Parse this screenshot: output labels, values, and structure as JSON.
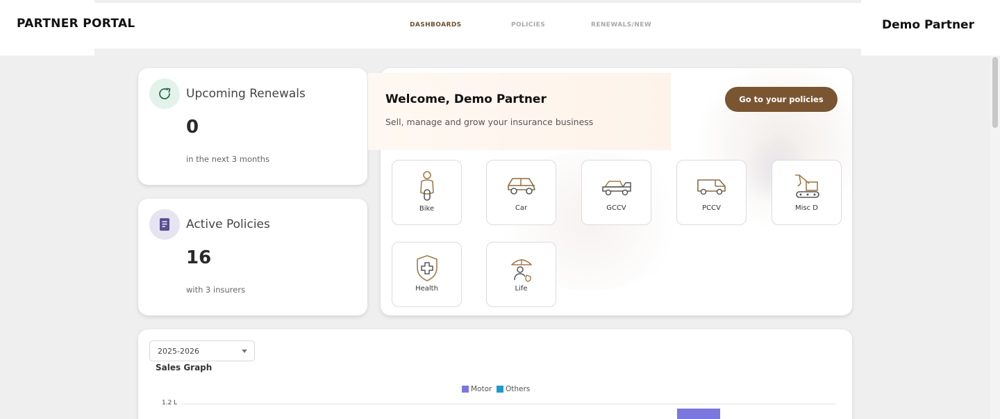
{
  "header": {
    "brand": "PARTNER PORTAL",
    "user_name": "Demo Partner",
    "nav": [
      {
        "label": "DASHBOARDS",
        "active": true
      },
      {
        "label": "POLICIES",
        "active": false
      },
      {
        "label": "RENEWALS/NEW",
        "active": false
      }
    ]
  },
  "stats": {
    "renewals": {
      "icon": "refresh-icon",
      "title": "Upcoming Renewals",
      "value": "0",
      "sub": "in the next 3 months"
    },
    "policies": {
      "icon": "document-icon",
      "title": "Active Policies",
      "value": "16",
      "sub": "with 3 insurers"
    }
  },
  "welcome": {
    "title": "Welcome, Demo Partner",
    "subtitle": "Sell, manage and grow your insurance business",
    "cta": "Go to your policies"
  },
  "products": [
    {
      "label": "Bike",
      "icon": "scooter-icon"
    },
    {
      "label": "Car",
      "icon": "car-icon"
    },
    {
      "label": "GCCV",
      "icon": "tow-truck-icon"
    },
    {
      "label": "PCCV",
      "icon": "van-icon"
    },
    {
      "label": "Misc D",
      "icon": "excavator-icon"
    },
    {
      "label": "Health",
      "icon": "health-shield-icon"
    },
    {
      "label": "Life",
      "icon": "life-umbrella-icon"
    }
  ],
  "sales": {
    "year_selected": "2025-2026",
    "title": "Sales Graph"
  },
  "chart_data": {
    "type": "bar",
    "title": "Sales Graph",
    "series": [
      {
        "name": "Motor",
        "color": "#7b77e0"
      },
      {
        "name": "Others",
        "color": "#1d9bd1"
      }
    ],
    "y_ticks": [
      "1.2 L"
    ]
  },
  "colors": {
    "accent": "#7a5532",
    "nav_active": "#6b4f2c",
    "motor": "#7b77e0",
    "others": "#1d9bd1"
  }
}
